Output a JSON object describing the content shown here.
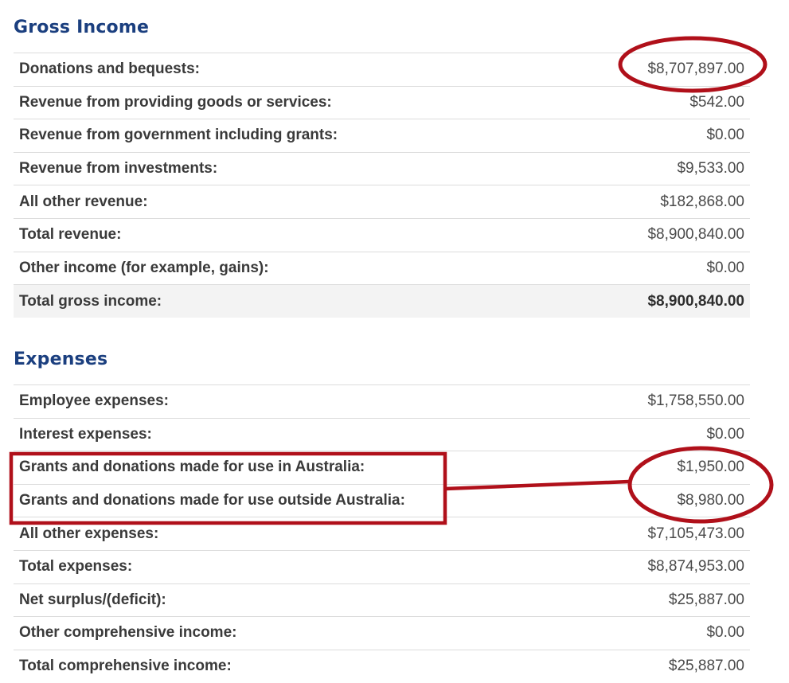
{
  "gross_income": {
    "title": "Gross Income",
    "rows": [
      {
        "label": "Donations and bequests:",
        "value": "$8,707,897.00"
      },
      {
        "label": "Revenue from providing goods or services:",
        "value": "$542.00"
      },
      {
        "label": "Revenue from government including grants:",
        "value": "$0.00"
      },
      {
        "label": "Revenue from investments:",
        "value": "$9,533.00"
      },
      {
        "label": "All other revenue:",
        "value": "$182,868.00"
      },
      {
        "label": "Total revenue:",
        "value": "$8,900,840.00"
      },
      {
        "label": "Other income (for example, gains):",
        "value": "$0.00"
      },
      {
        "label": "Total gross income:",
        "value": "$8,900,840.00"
      }
    ]
  },
  "expenses": {
    "title": "Expenses",
    "rows": [
      {
        "label": "Employee expenses:",
        "value": "$1,758,550.00"
      },
      {
        "label": "Interest expenses:",
        "value": "$0.00"
      },
      {
        "label": "Grants and donations made for use in Australia:",
        "value": "$1,950.00"
      },
      {
        "label": "Grants and donations made for use outside Australia:",
        "value": "$8,980.00"
      },
      {
        "label": "All other expenses:",
        "value": "$7,105,473.00"
      },
      {
        "label": "Total expenses:",
        "value": "$8,874,953.00"
      },
      {
        "label": "Net surplus/(deficit):",
        "value": "$25,887.00"
      },
      {
        "label": "Other comprehensive income:",
        "value": "$0.00"
      },
      {
        "label": "Total comprehensive income:",
        "value": "$25,887.00"
      }
    ]
  },
  "colors": {
    "heading": "#1b3f7f",
    "annotation": "#b0101a",
    "total_row_background": "#f3f3f3"
  }
}
